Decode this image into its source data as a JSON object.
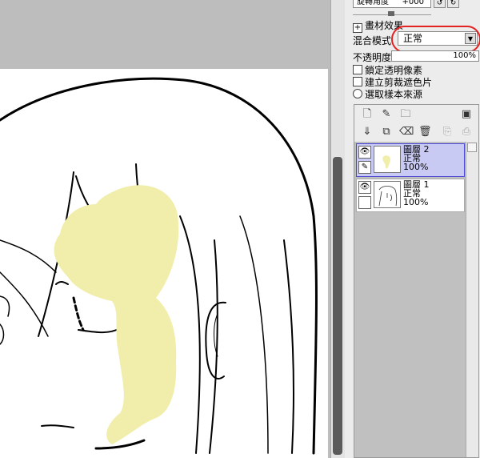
{
  "toolbar": {
    "rotation_label": "旋轉角度",
    "rotation_value": "+000",
    "rotate_ccw_icon": "rotate-left-icon",
    "rotate_cw_icon": "rotate-right-icon"
  },
  "material": {
    "expand_icon": "plus-box-icon",
    "label": "畫材效果"
  },
  "blend": {
    "label": "混合模式",
    "value": "正常"
  },
  "opacity": {
    "label": "不透明度",
    "value": "100%",
    "level": 1.0
  },
  "options": {
    "lock_transparency": "鎖定透明像素",
    "clipping_group": "建立剪裁遮色片",
    "sampling_source": "選取樣本來源"
  },
  "layers": [
    {
      "name": "圖層",
      "index": "2",
      "mode": "正常",
      "opacity": "100%",
      "selected": true
    },
    {
      "name": "圖層",
      "index": "1",
      "mode": "正常",
      "opacity": "100%",
      "selected": false
    }
  ],
  "colors": {
    "highlight_stroke": "#e32222",
    "selected_layer_bg": "#c9caf3",
    "paint_color": "#f0eeaa"
  }
}
